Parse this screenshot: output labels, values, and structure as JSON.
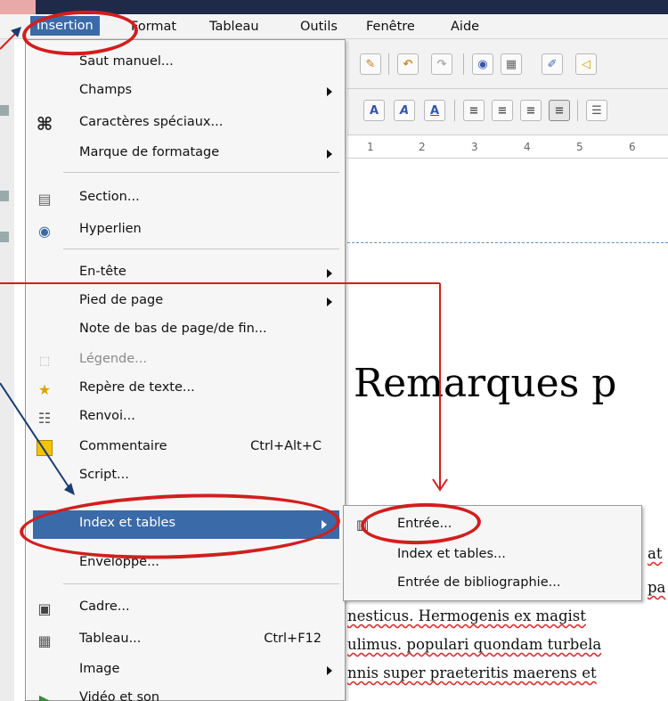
{
  "menubar": {
    "items": [
      {
        "label": "Insertion"
      },
      {
        "label": "Format"
      },
      {
        "label": "Tableau"
      },
      {
        "label": "Outils"
      },
      {
        "label": "Fenêtre"
      },
      {
        "label": "Aide"
      }
    ]
  },
  "menu": {
    "items": [
      {
        "label": "Saut manuel...",
        "icon": "none"
      },
      {
        "label": "Champs",
        "submenu": true
      },
      {
        "label": "Caractères spéciaux...",
        "icon": "command-icon"
      },
      {
        "label": "Marque de formatage",
        "submenu": true
      },
      {
        "label": "Section...",
        "icon": "section-icon"
      },
      {
        "label": "Hyperlien",
        "icon": "hyperlink-icon"
      },
      {
        "label": "En-tête",
        "submenu": true
      },
      {
        "label": "Pied de page",
        "submenu": true
      },
      {
        "label": "Note de bas de page/de fin..."
      },
      {
        "label": "Légende...",
        "icon": "caption-icon",
        "disabled": true
      },
      {
        "label": "Repère de texte...",
        "icon": "bookmark-icon"
      },
      {
        "label": "Renvoi...",
        "icon": "cross-reference-icon"
      },
      {
        "label": "Commentaire",
        "shortcut": "Ctrl+Alt+C",
        "icon": "comment-icon"
      },
      {
        "label": "Script..."
      },
      {
        "label": "Index et tables",
        "submenu": true,
        "highlighted": true
      },
      {
        "label": "Enveloppe..."
      },
      {
        "label": "Cadre...",
        "icon": "frame-icon"
      },
      {
        "label": "Tableau...",
        "shortcut": "Ctrl+F12",
        "icon": "table-icon"
      },
      {
        "label": "Image",
        "submenu": true
      },
      {
        "label": "Vidéo et son",
        "icon": "video-icon"
      }
    ]
  },
  "submenu": {
    "items": [
      {
        "label": "Entrée...",
        "icon": "index-entry-icon"
      },
      {
        "label": "Index et tables..."
      },
      {
        "label": "Entrée de bibliographie..."
      }
    ]
  },
  "document": {
    "title": "Remarques p",
    "lines": [
      "at",
      "pa",
      "nesticus. Hermogenis ex magist",
      "ulimus. populari quondam turbela",
      "nnis super praeteritis maerens et"
    ]
  },
  "ruler": {
    "ticks": [
      "1",
      "2",
      "3",
      "4",
      "5",
      "6"
    ]
  },
  "colors": {
    "highlight": "#3b6aa8",
    "annotation": "#d21e1e"
  }
}
